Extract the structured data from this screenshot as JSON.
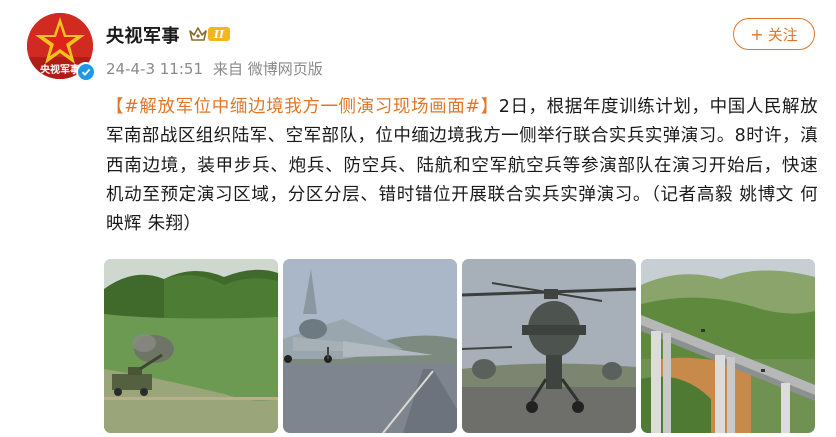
{
  "account": {
    "name": "央视军事",
    "avatar_text": "央视军事",
    "level": "II",
    "verified": true
  },
  "post_meta": {
    "timestamp": "24-4-3 11:51",
    "source": "来自 微博网页版"
  },
  "follow_button": {
    "label": "关注",
    "icon": "plus-icon"
  },
  "post": {
    "bracket_open": "【",
    "topic": "#解放军位中缅边境我方一侧演习现场画面#",
    "bracket_close": "】",
    "body": "2日，根据年度训练计划，中国人民解放军南部战区组织陆军、空军部队，位中缅边境我方一侧举行联合实兵实弹演习。8时许，滇西南边境，装甲步兵、炮兵、防空兵、陆航和空军航空兵等参演部队在演习开始后，快速机动至预定演习区域，分区分层、错时错位开展联合实兵实弹演习。（记者高毅 姚博文 何映辉 朱翔）"
  },
  "colors": {
    "accent_orange": "#e0772a",
    "verified_blue": "#1f98e8",
    "level_gold": "#f5b51c",
    "meta_gray": "#8a8a8a"
  },
  "photos": [
    {
      "subject": "artillery-firing-photo"
    },
    {
      "subject": "fighter-jet-runway-photo"
    },
    {
      "subject": "attack-helicopters-photo"
    },
    {
      "subject": "highway-bridge-mountains-photo"
    }
  ]
}
